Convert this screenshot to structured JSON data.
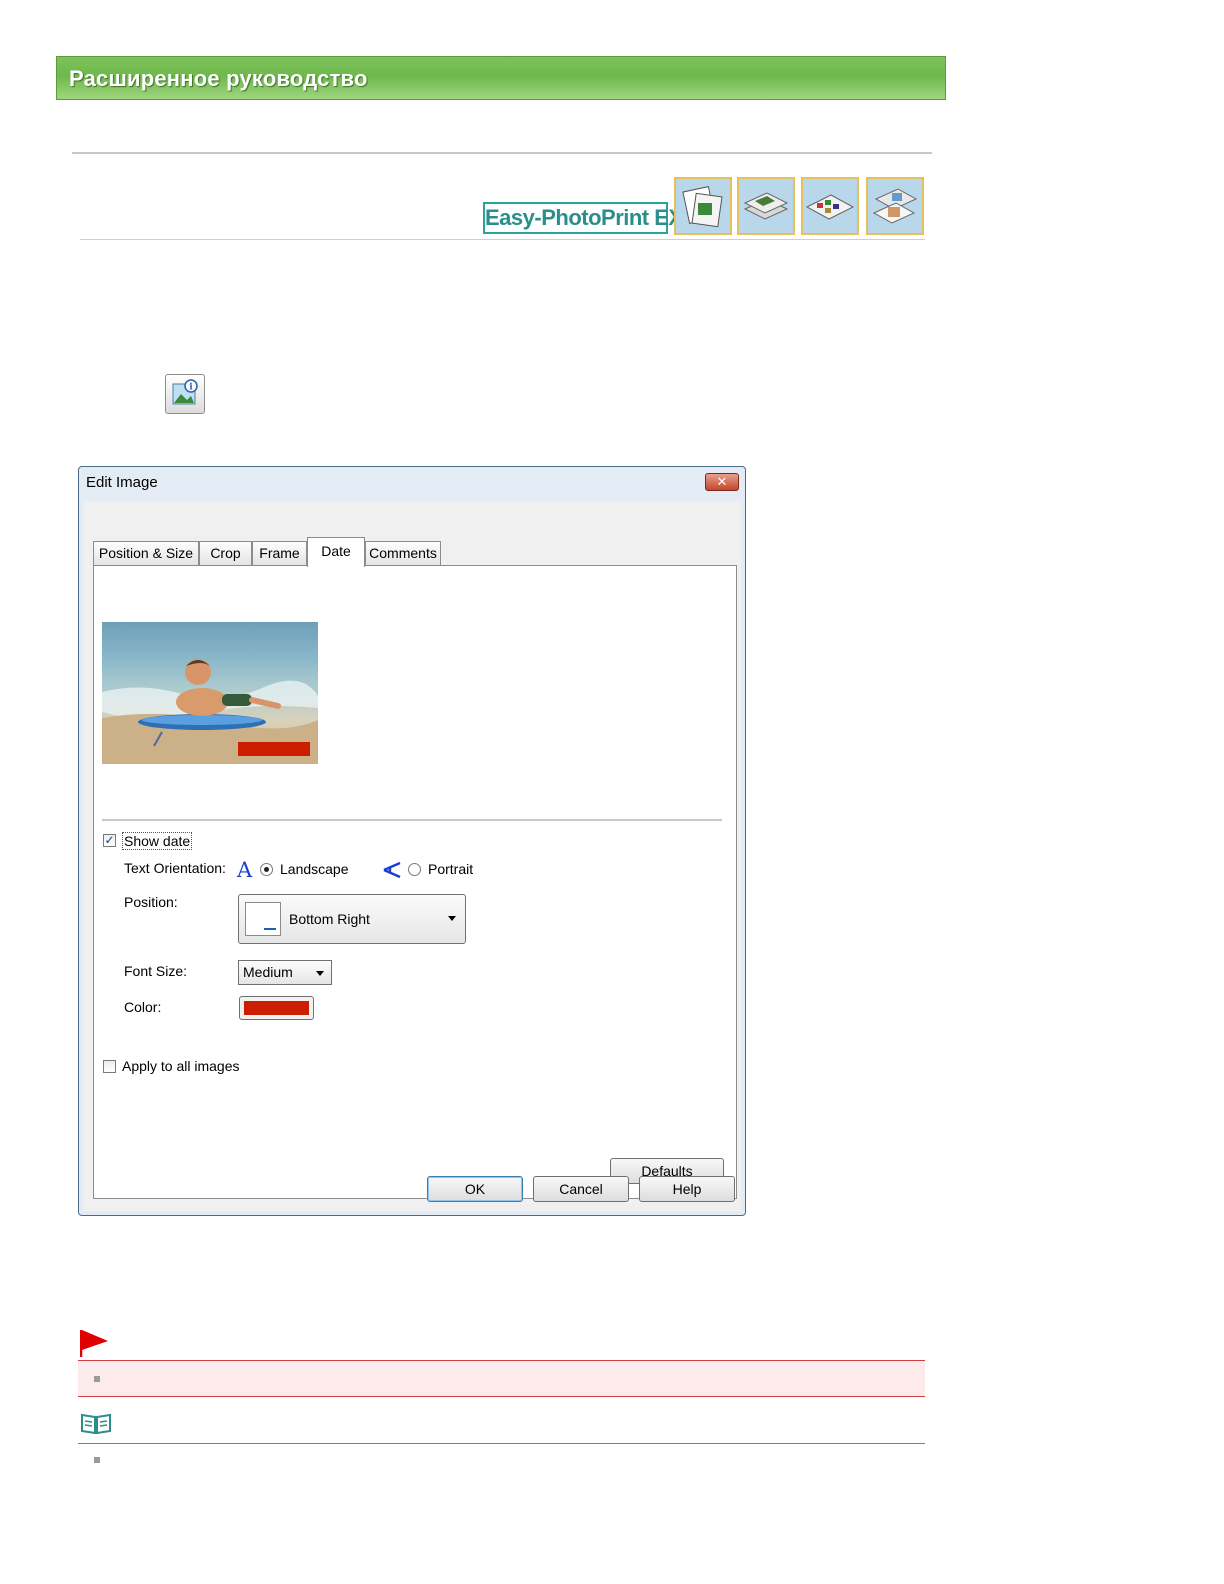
{
  "banner": {
    "title": "Расширенное руководство"
  },
  "logo": {
    "text": "Easy-PhotoPrint EX"
  },
  "app_icons": [
    "album-icon",
    "stack-icon",
    "layout-icon",
    "photos-icon"
  ],
  "toolbar_icon": "edit-image-info-icon",
  "dialog": {
    "title": "Edit Image",
    "close_label": "✕",
    "tabs": [
      {
        "label": "Position & Size",
        "active": false
      },
      {
        "label": "Crop",
        "active": false
      },
      {
        "label": "Frame",
        "active": false
      },
      {
        "label": "Date",
        "active": true
      },
      {
        "label": "Comments",
        "active": false
      }
    ],
    "show_date": {
      "label": "Show date",
      "checked": true
    },
    "text_orientation": {
      "label": "Text Orientation:",
      "landscape": "Landscape",
      "portrait": "Portrait",
      "selected": "Landscape"
    },
    "position": {
      "label": "Position:",
      "value": "Bottom Right"
    },
    "font_size": {
      "label": "Font Size:",
      "value": "Medium"
    },
    "color": {
      "label": "Color:",
      "value": "#cc1e00"
    },
    "apply_all": {
      "label": "Apply to all images",
      "checked": false
    },
    "defaults_label": "Defaults",
    "ok_label": "OK",
    "cancel_label": "Cancel",
    "help_label": "Help"
  },
  "colors": {
    "banner": "#6eb84c",
    "date": "#cc1e00",
    "logo": "#2aa39a",
    "caution": "#d04040"
  }
}
